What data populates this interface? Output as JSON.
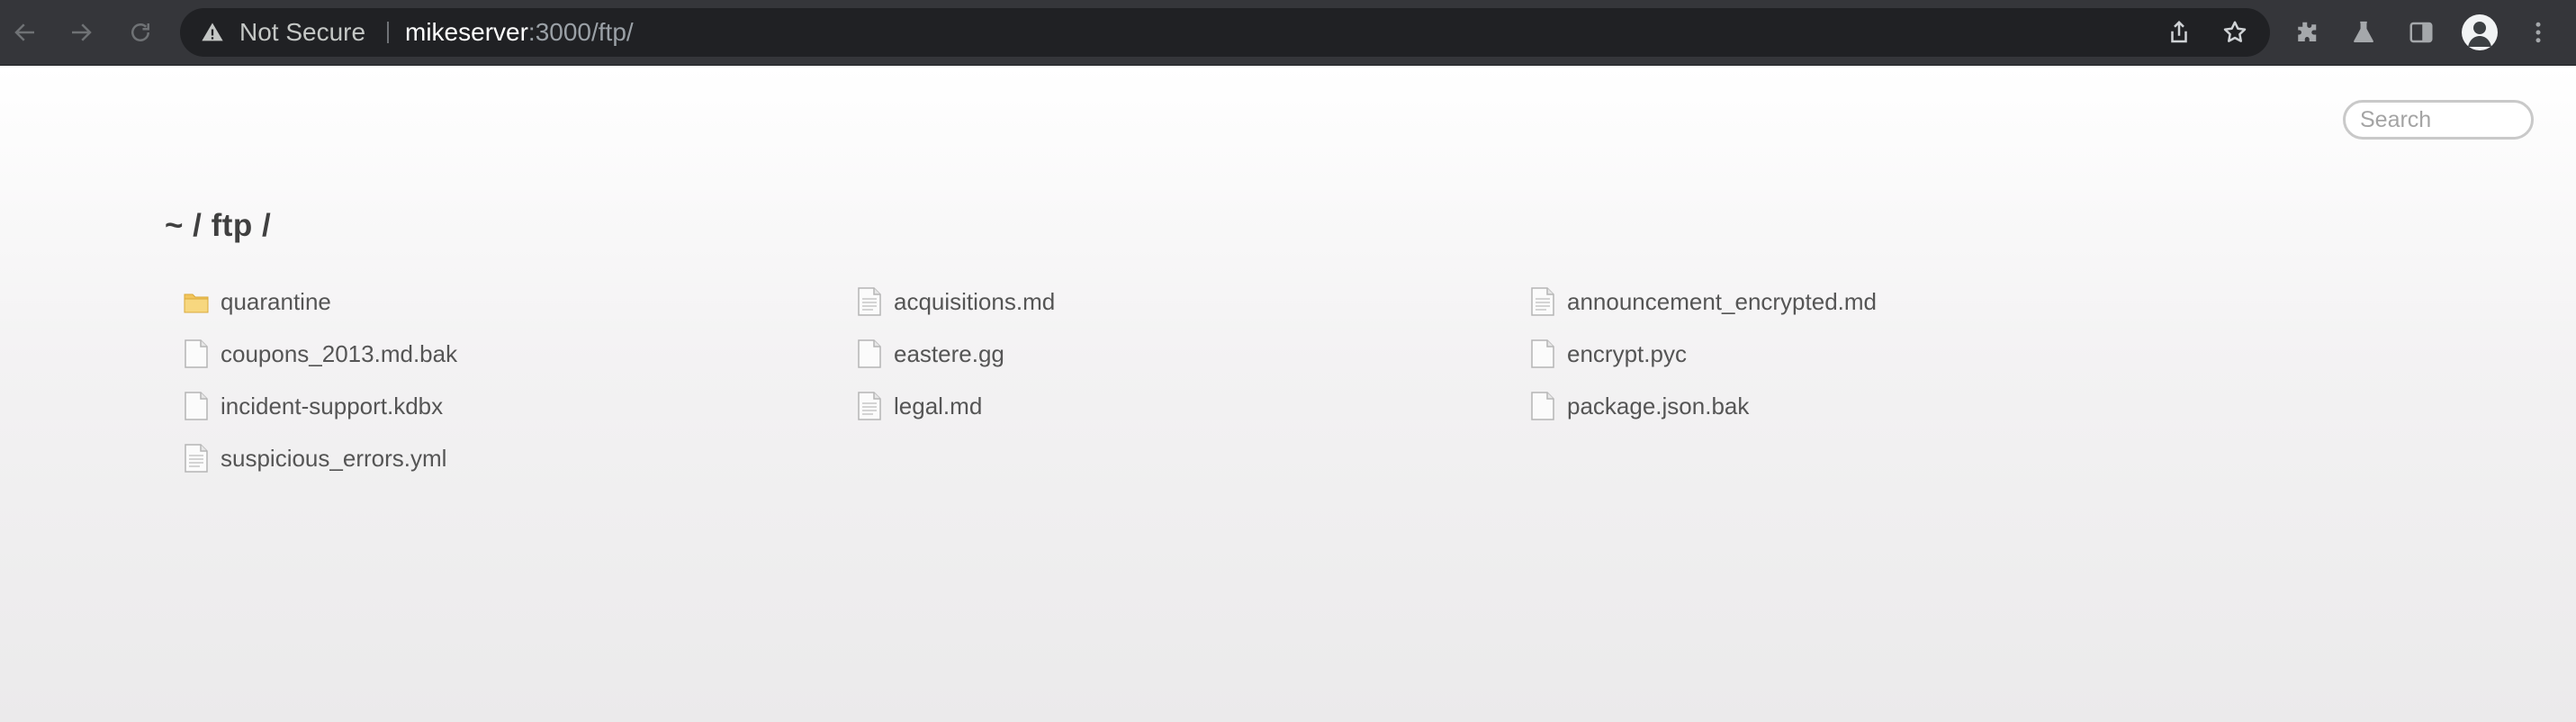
{
  "browser": {
    "security_label": "Not Secure",
    "url_host": "mikeserver",
    "url_rest": ":3000/ftp/",
    "icons": [
      "back-icon",
      "forward-icon",
      "reload-icon",
      "warning-icon",
      "share-icon",
      "star-icon",
      "extensions-icon",
      "labs-icon",
      "side-panel-icon",
      "profile-icon",
      "menu-icon"
    ]
  },
  "search": {
    "placeholder": "Search"
  },
  "breadcrumb": "~ / ftp /",
  "files": [
    {
      "name": "quarantine",
      "type": "folder"
    },
    {
      "name": "acquisitions.md",
      "type": "text"
    },
    {
      "name": "announcement_encrypted.md",
      "type": "text"
    },
    {
      "name": "coupons_2013.md.bak",
      "type": "file"
    },
    {
      "name": "eastere.gg",
      "type": "file"
    },
    {
      "name": "encrypt.pyc",
      "type": "file"
    },
    {
      "name": "incident-support.kdbx",
      "type": "file"
    },
    {
      "name": "legal.md",
      "type": "text"
    },
    {
      "name": "package.json.bak",
      "type": "file"
    },
    {
      "name": "suspicious_errors.yml",
      "type": "text"
    }
  ],
  "colors": {
    "toolbar": "#35363a",
    "omnibox": "#202124",
    "link_text": "#555555",
    "folder": "#f2c55c"
  }
}
